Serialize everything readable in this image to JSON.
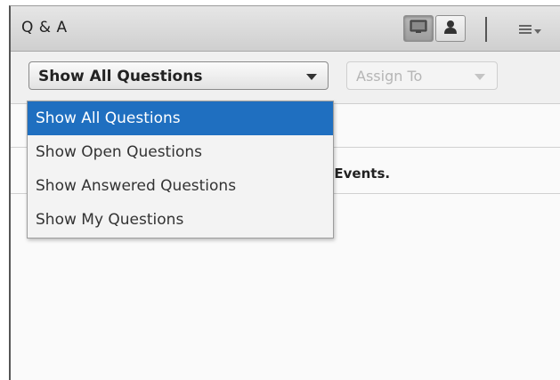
{
  "header": {
    "title": "Q & A"
  },
  "toolbar": {
    "filter_value": "Show All Questions",
    "assign_value": "Assign To"
  },
  "dropdown": {
    "options": [
      "Show All Questions",
      "Show Open Questions",
      "Show Answered Questions",
      "Show My Questions"
    ],
    "selected_index": 0
  },
  "list": {
    "partial_text": "t Events."
  },
  "colors": {
    "selection": "#1f6fc0",
    "header_bg": "#d8d8d8"
  },
  "icons": [
    "presenter-view-icon",
    "participant-view-icon",
    "menu-icon",
    "dropdown-caret-icon"
  ]
}
